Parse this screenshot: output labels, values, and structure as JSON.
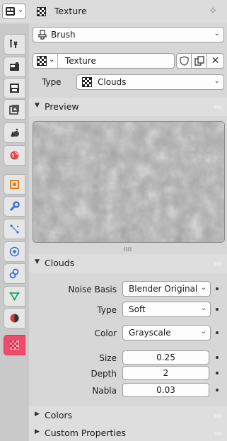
{
  "header": {
    "editor_type_icon": "properties-grid-icon",
    "title": "Texture",
    "pin_icon": "pin-icon"
  },
  "tabs": [
    {
      "name": "tool",
      "icon": "tool-icon"
    },
    {
      "name": "render",
      "icon": "render-icon"
    },
    {
      "name": "output",
      "icon": "output-icon"
    },
    {
      "name": "view-layer",
      "icon": "view-layer-icon"
    },
    {
      "name": "scene",
      "icon": "scene-icon"
    },
    {
      "name": "world",
      "icon": "world-icon"
    },
    {
      "name": "object",
      "icon": "object-icon"
    },
    {
      "name": "modifiers",
      "icon": "wrench-icon"
    },
    {
      "name": "particles",
      "icon": "particles-icon"
    },
    {
      "name": "physics",
      "icon": "physics-icon"
    },
    {
      "name": "constraints",
      "icon": "constraints-icon"
    },
    {
      "name": "object-data",
      "icon": "mesh-data-icon"
    },
    {
      "name": "material",
      "icon": "material-icon"
    },
    {
      "name": "texture",
      "icon": "texture-icon",
      "active": true
    }
  ],
  "texture_user": {
    "label": "Brush",
    "icon": "brush-icon"
  },
  "texture_datablock": {
    "name": "Texture",
    "icons": [
      "fake-user-shield-icon",
      "duplicate-icon",
      "unlink-x-icon"
    ]
  },
  "type_row": {
    "label": "Type",
    "value": "Clouds"
  },
  "preview_panel": {
    "label": "Preview"
  },
  "clouds_panel": {
    "label": "Clouds",
    "noise_basis": {
      "label": "Noise Basis",
      "value": "Blender Original"
    },
    "type": {
      "label": "Type",
      "value": "Soft"
    },
    "color": {
      "label": "Color",
      "value": "Grayscale"
    },
    "size": {
      "label": "Size",
      "value": "0.25"
    },
    "depth": {
      "label": "Depth",
      "value": "2"
    },
    "nabla": {
      "label": "Nabla",
      "value": "0.03"
    }
  },
  "collapsed_panels": {
    "colors": "Colors",
    "custom_properties": "Custom Properties"
  },
  "colors": {
    "active_tab": "#f04a6a",
    "panel_header": "#dedede",
    "background": "#d7d7d7"
  }
}
